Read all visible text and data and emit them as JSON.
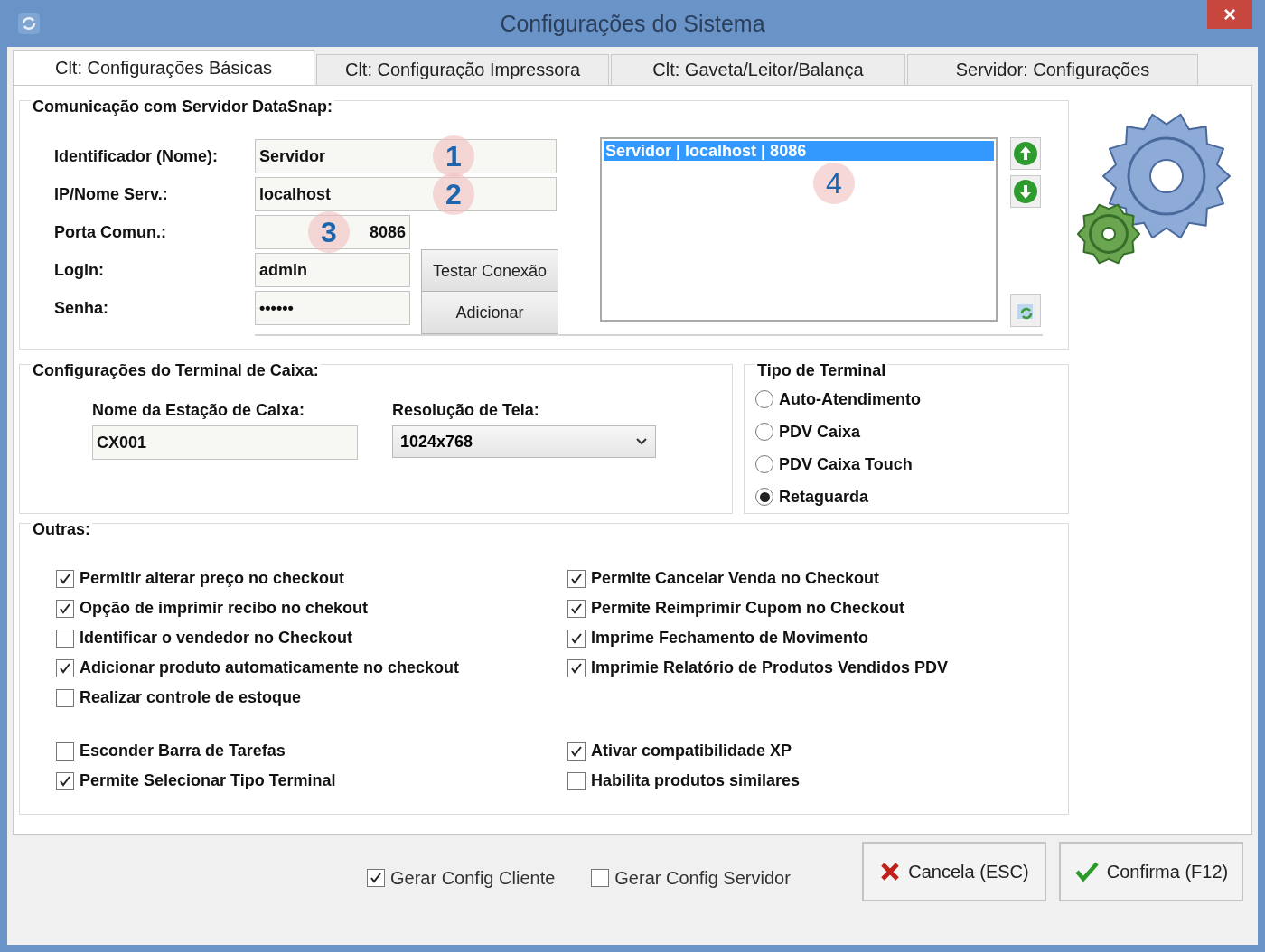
{
  "window": {
    "title": "Configurações do Sistema",
    "close": "×"
  },
  "tabs": [
    {
      "label": "Clt: Configurações Básicas",
      "selected": true
    },
    {
      "label": "Clt: Configuração Impressora",
      "selected": false
    },
    {
      "label": "Clt: Gaveta/Leitor/Balança",
      "selected": false
    },
    {
      "label": "Servidor: Configurações",
      "selected": false
    }
  ],
  "datasnap": {
    "title": "Comunicação com Servidor DataSnap:",
    "fields": [
      {
        "label": "Identificador (Nome):",
        "value": "Servidor",
        "kind": "wide",
        "marker": "1"
      },
      {
        "label": "IP/Nome Serv.:",
        "value": "localhost",
        "kind": "wide",
        "marker": "2"
      },
      {
        "label": "Porta Comun.:",
        "value": "8086",
        "kind": "number",
        "marker": "3"
      },
      {
        "label": "Login:",
        "value": "admin",
        "kind": "short"
      },
      {
        "label": "Senha:",
        "value": "••••••",
        "kind": "short"
      }
    ],
    "buttons": [
      "Testar Conexão",
      "Adicionar"
    ],
    "servers": [
      {
        "label": "Servidor | localhost | 8086",
        "selected": true
      }
    ],
    "list_marker": "4"
  },
  "terminal": {
    "title": "Configurações do Terminal de Caixa:",
    "station": {
      "label": "Nome da Estação de Caixa:",
      "value": "CX001"
    },
    "resolution": {
      "label": "Resolução de Tela:",
      "value": "1024x768"
    }
  },
  "terminal_type": {
    "title": "Tipo de Terminal",
    "options": [
      {
        "label": "Auto-Atendimento",
        "selected": false
      },
      {
        "label": "PDV Caixa",
        "selected": false
      },
      {
        "label": "PDV Caixa Touch",
        "selected": false
      },
      {
        "label": "Retaguarda",
        "selected": true
      }
    ]
  },
  "outras": {
    "title": "Outras:",
    "groups": [
      {
        "left": [
          {
            "label": "Permitir alterar preço no checkout",
            "checked": true
          },
          {
            "label": "Opção de imprimir recibo no chekout",
            "checked": true
          },
          {
            "label": "Identificar o vendedor no Checkout",
            "checked": false
          },
          {
            "label": "Adicionar produto automaticamente no checkout",
            "checked": true
          },
          {
            "label": "Realizar controle de estoque",
            "checked": false
          }
        ],
        "right": [
          {
            "label": "Permite Cancelar Venda no Checkout",
            "checked": true
          },
          {
            "label": "Permite Reimprimir Cupom no Checkout",
            "checked": true
          },
          {
            "label": "Imprime Fechamento de Movimento",
            "checked": true
          },
          {
            "label": "Imprimie Relatório de Produtos Vendidos PDV",
            "checked": true
          }
        ]
      },
      {
        "left": [
          {
            "label": "Esconder Barra de Tarefas",
            "checked": false
          },
          {
            "label": "Permite Selecionar Tipo Terminal",
            "checked": true
          }
        ],
        "right": [
          {
            "label": "Ativar compatibilidade XP",
            "checked": true
          },
          {
            "label": "Habilita produtos similares",
            "checked": false
          }
        ]
      }
    ]
  },
  "footer": {
    "options": [
      {
        "label": "Gerar Config Cliente",
        "checked": true
      },
      {
        "label": "Gerar Config Servidor",
        "checked": false
      }
    ],
    "buttons": [
      {
        "label": "Cancela (ESC)",
        "kind": "cancel"
      },
      {
        "label": "Confirma (F12)",
        "kind": "confirm"
      }
    ]
  }
}
